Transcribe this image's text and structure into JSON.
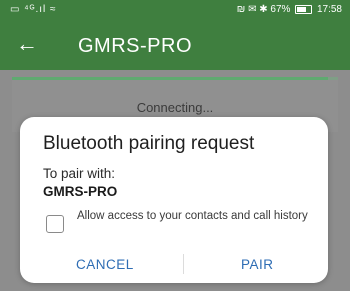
{
  "status_bar": {
    "left_text": "▭ ⁴ᴳ.ıl ≈",
    "right_text": "₪ ✉ ✱ 67%",
    "time": "17:58"
  },
  "app_bar": {
    "back_icon": "←",
    "title": "GMRS-PRO"
  },
  "progress": {
    "fraction": 0.97
  },
  "main": {
    "connecting_text": "Connecting..."
  },
  "dialog": {
    "title": "Bluetooth pairing request",
    "pair_with_label": "To pair with:",
    "device_name": "GMRS-PRO",
    "checkbox_label": "Allow access to your contacts and call history",
    "checkbox_checked": false,
    "cancel_label": "CANCEL",
    "pair_label": "PAIR"
  }
}
